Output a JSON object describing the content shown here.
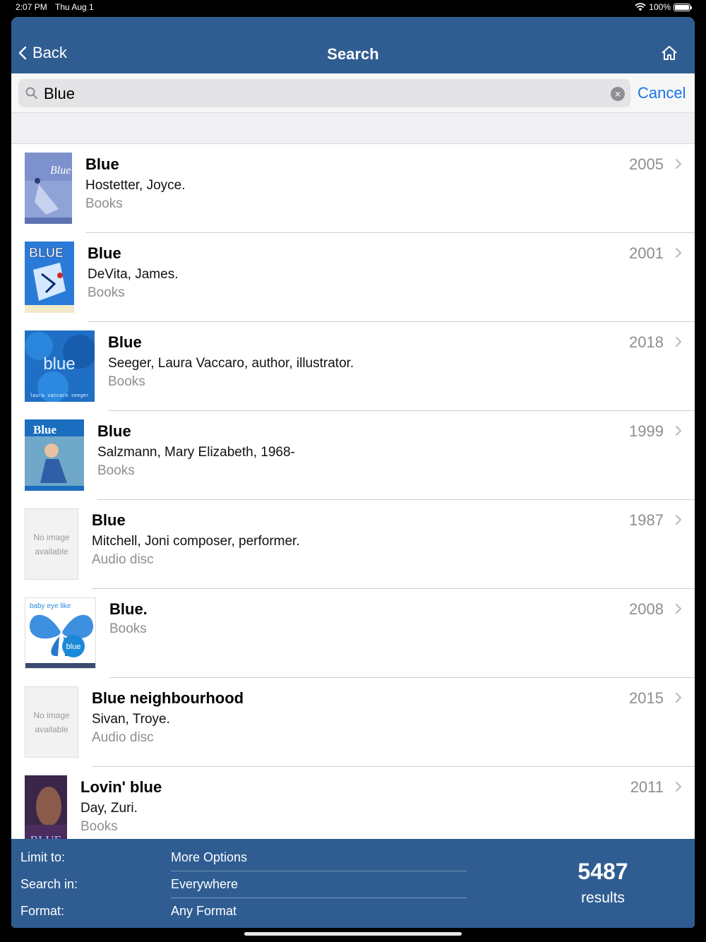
{
  "status": {
    "time": "2:07 PM",
    "date": "Thu Aug 1",
    "battery": "100%"
  },
  "nav": {
    "back_label": "Back",
    "title": "Search",
    "accent": "#2f5d92"
  },
  "search": {
    "query": "Blue",
    "cancel_label": "Cancel"
  },
  "results": [
    {
      "title": "Blue",
      "author": "Hostetter, Joyce.",
      "format": "Books",
      "year": "2005",
      "cover": "cover-blue-hostetter"
    },
    {
      "title": "Blue",
      "author": "DeVita, James.",
      "format": "Books",
      "year": "2001",
      "cover": "cover-blue-devita"
    },
    {
      "title": "Blue",
      "author": "Seeger, Laura Vaccaro, author, illustrator.",
      "format": "Books",
      "year": "2018",
      "cover": "cover-blue-seeger",
      "cover_text": "blue",
      "cover_subtext": "laura vaccaro seeger"
    },
    {
      "title": "Blue",
      "author": "Salzmann, Mary Elizabeth, 1968-",
      "format": "Books",
      "year": "1999",
      "cover": "cover-blue-salzmann"
    },
    {
      "title": "Blue",
      "author": "Mitchell, Joni composer, performer.",
      "format": "Audio disc",
      "year": "1987",
      "cover": "no-image",
      "noimg_text": "No image available"
    },
    {
      "title": "Blue.",
      "author": "",
      "format": "Books",
      "year": "2008",
      "cover": "cover-blue-baby",
      "cover_text": "baby eye like",
      "cover_subtext": "blue"
    },
    {
      "title": "Blue neighbourhood",
      "author": "Sivan, Troye.",
      "format": "Audio disc",
      "year": "2015",
      "cover": "no-image",
      "noimg_text": "No image available"
    },
    {
      "title": "Lovin' blue",
      "author": "Day, Zuri.",
      "format": "Books",
      "year": "2011",
      "cover": "cover-lovin-blue"
    }
  ],
  "footer": {
    "limit_label": "Limit to:",
    "limit_value": "More Options",
    "searchin_label": "Search in:",
    "searchin_value": "Everywhere",
    "format_label": "Format:",
    "format_value": "Any Format",
    "count": "5487",
    "count_label": "results"
  }
}
